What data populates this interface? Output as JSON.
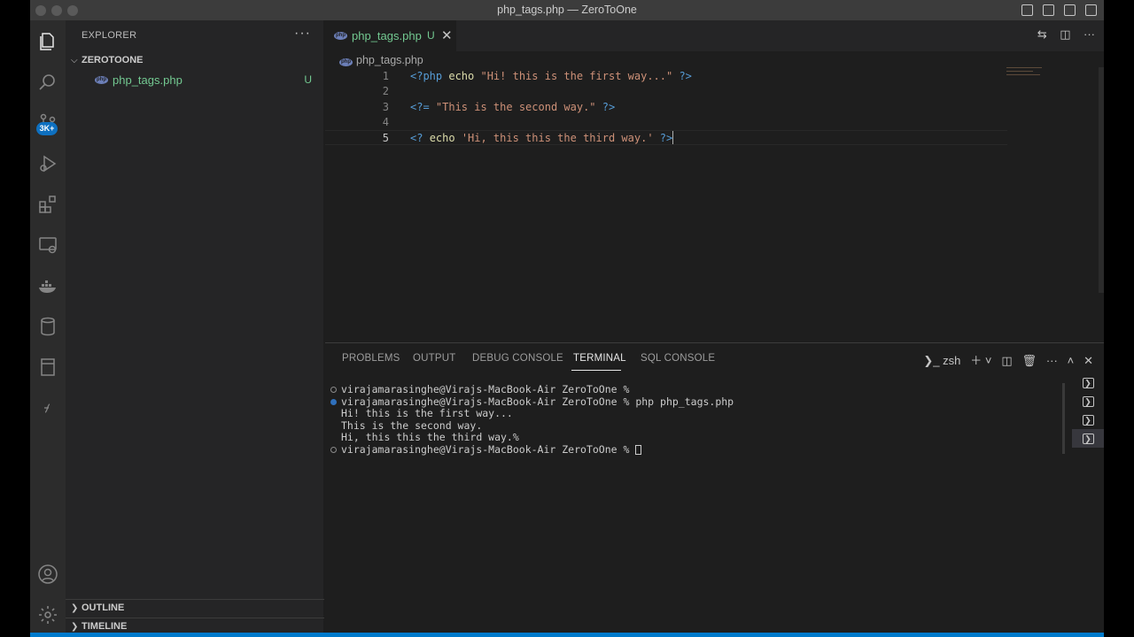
{
  "window": {
    "title": "php_tags.php — ZeroToOne"
  },
  "activity_bar": {
    "source_control_badge": "3K+",
    "icons": [
      "explorer-icon",
      "search-icon",
      "source-control-icon",
      "run-debug-icon",
      "extensions-icon",
      "remote-explorer-icon",
      "docker-icon",
      "database-icon",
      "book-icon",
      "symfony-icon",
      "account-icon",
      "settings-gear-icon"
    ]
  },
  "sidebar": {
    "header": "EXPLORER",
    "more": "···",
    "folder": "ZEROTOONE",
    "files": [
      {
        "name": "php_tags.php",
        "status": "U",
        "icon": "php-file-icon"
      }
    ],
    "outline_label": "OUTLINE",
    "timeline_label": "TIMELINE"
  },
  "editor": {
    "tab": {
      "label": "php_tags.php",
      "status": "U",
      "icon_text": "php"
    },
    "breadcrumb": "php_tags.php",
    "lines": [
      {
        "number": "1",
        "tokens": [
          {
            "t": "<?php ",
            "c": "tag"
          },
          {
            "t": "echo ",
            "c": "kw"
          },
          {
            "t": "\"Hi! this is the first way...\"",
            "c": "str"
          },
          {
            "t": " ?>",
            "c": "tag"
          }
        ]
      },
      {
        "number": "2",
        "tokens": []
      },
      {
        "number": "3",
        "tokens": [
          {
            "t": "<?= ",
            "c": "tag"
          },
          {
            "t": "\"This is the second way.\"",
            "c": "str"
          },
          {
            "t": " ?>",
            "c": "tag"
          }
        ]
      },
      {
        "number": "4",
        "tokens": []
      },
      {
        "number": "5",
        "tokens": [
          {
            "t": "<? ",
            "c": "tag"
          },
          {
            "t": "echo ",
            "c": "kw"
          },
          {
            "t": "'Hi, this this the third way.'",
            "c": "str"
          },
          {
            "t": " ?>",
            "c": "tag"
          }
        ],
        "current": true
      }
    ]
  },
  "panel": {
    "tabs": [
      {
        "label": "PROBLEMS",
        "active": false
      },
      {
        "label": "OUTPUT",
        "active": false
      },
      {
        "label": "DEBUG CONSOLE",
        "active": false
      },
      {
        "label": "TERMINAL",
        "active": true
      },
      {
        "label": "SQL CONSOLE",
        "active": false
      }
    ],
    "shell": "zsh",
    "terminal_lines": [
      {
        "marker": "hollow",
        "text": "virajamarasinghe@Virajs-MacBook-Air ZeroToOne % "
      },
      {
        "marker": "blue",
        "text": "virajamarasinghe@Virajs-MacBook-Air ZeroToOne % php php_tags.php"
      },
      {
        "marker": "none",
        "text": "Hi! this is the first way..."
      },
      {
        "marker": "none",
        "text": "This is the second way."
      },
      {
        "marker": "none",
        "text": "Hi, this this the third way.%"
      },
      {
        "marker": "hollow",
        "text": "virajamarasinghe@Virajs-MacBook-Air ZeroToOne % ",
        "cursor": true
      }
    ]
  },
  "colors": {
    "accent": "#007acc",
    "untracked": "#73c991",
    "tag": "#569cd6",
    "string": "#ce9178",
    "keyword": "#dcdcaa"
  }
}
